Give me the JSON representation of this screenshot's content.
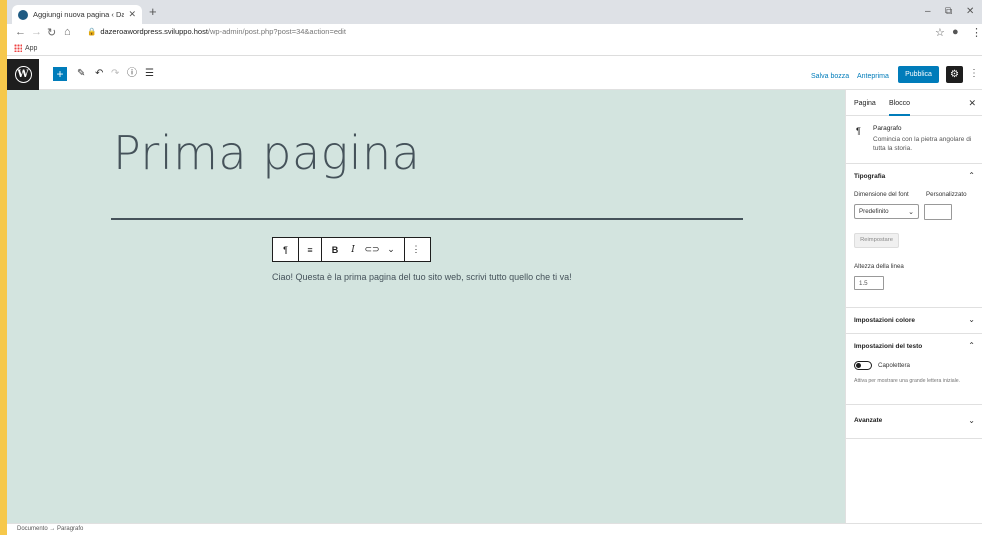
{
  "browser": {
    "tab_title": "Aggiungi nuova pagina ‹ Da Zero",
    "tab_close": "✕",
    "new_tab": "+",
    "url_host": "dazeroawordpress.sviluppo.host",
    "url_path": "/wp-admin/post.php?post=34&action=edit",
    "bookmark_apps": "App",
    "window_controls": {
      "minimize": "–",
      "restore": "⧉",
      "close": "✕"
    }
  },
  "toolbar": {
    "wp_logo": "W",
    "add_block": "+",
    "save_draft": "Salva bozza",
    "preview": "Anteprima",
    "publish": "Pubblica"
  },
  "editor": {
    "title": "Prima pagina",
    "paragraph": "Ciao! Questa è la prima pagina del tuo sito web, scrivi tutto quello che ti va!",
    "block_toolbar": {
      "paragraph": "¶",
      "align": "≡",
      "bold": "B",
      "italic": "I",
      "link": "⊂⊃",
      "more": "⌄",
      "options": "⋮"
    }
  },
  "sidebar": {
    "tabs": [
      "Pagina",
      "Blocco"
    ],
    "active_tab": "Blocco",
    "close": "✕",
    "block": {
      "icon": "¶",
      "name": "Paragrafo",
      "description": "Comincia con la pietra angolare di tutta la storia."
    },
    "typography": {
      "title": "Tipografia",
      "font_size_label": "Dimensione del font",
      "custom_label": "Personalizzato",
      "font_size_value": "Predefinito",
      "reset_label": "Reimpostare",
      "line_height_label": "Altezza della linea",
      "line_height_value": "1.5"
    },
    "color_settings": {
      "title": "Impostazioni colore"
    },
    "text_settings": {
      "title": "Impostazioni del testo",
      "toggle_label": "Capolettera",
      "help": "Attiva per mostrare una grande lettera iniziale."
    },
    "advanced": {
      "title": "Avanzate"
    }
  },
  "footer": {
    "breadcrumb": "Documento  →  Paragrafo"
  },
  "colors": {
    "accent": "#007cba",
    "editor_bg": "#d3e4df",
    "frame_bg": "#f6c84b"
  }
}
